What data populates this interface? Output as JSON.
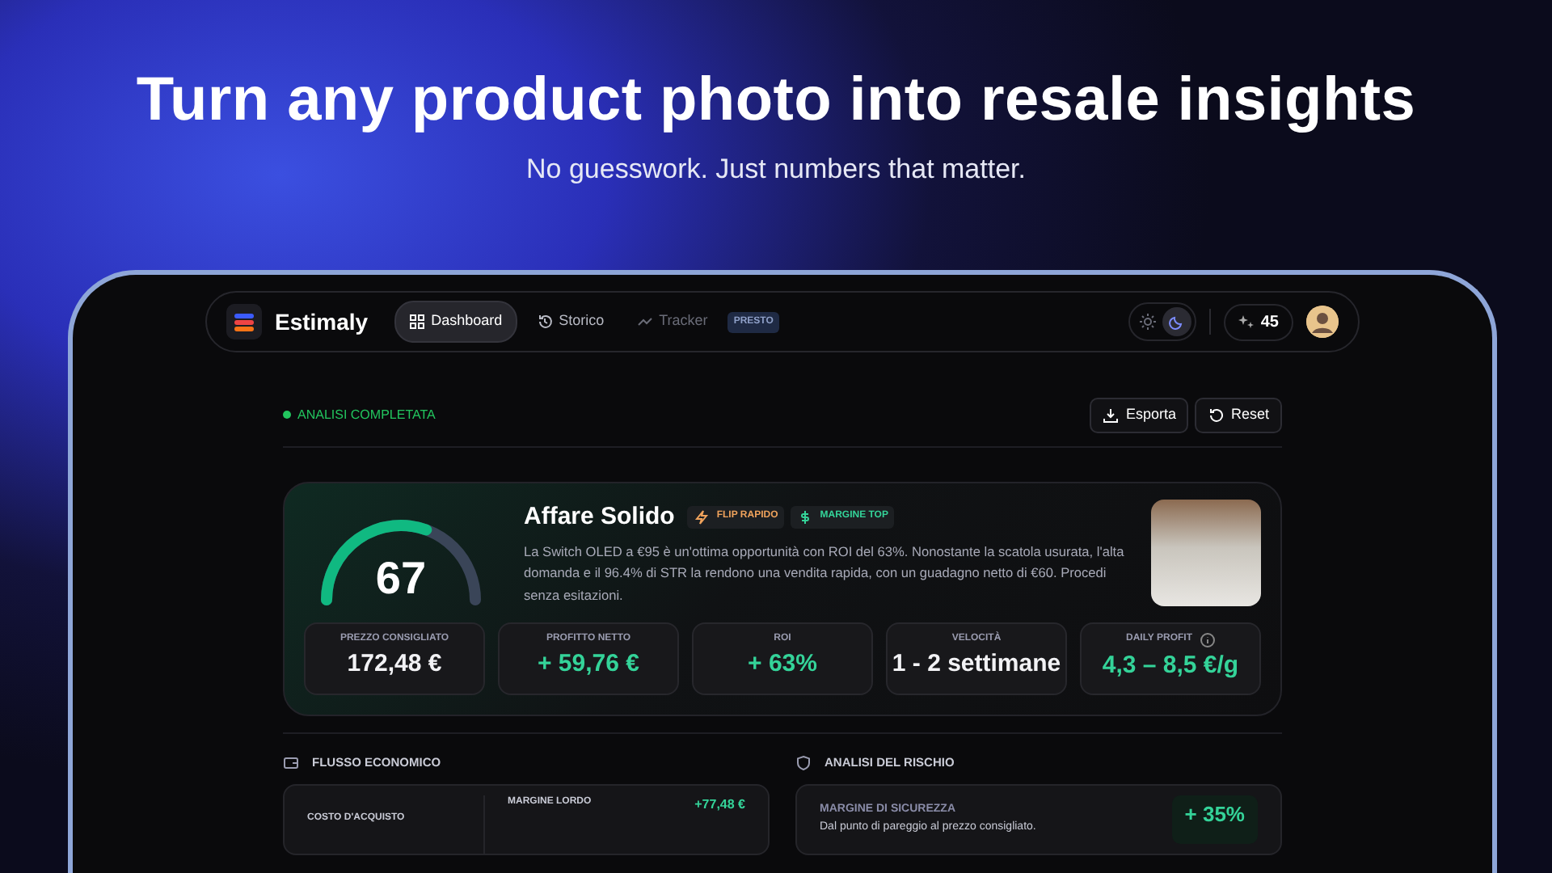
{
  "hero": {
    "title": "Turn any product photo into resale insights",
    "subtitle": "No guesswork. Just numbers that matter."
  },
  "nav": {
    "brand": "Estimaly",
    "tabs": [
      {
        "label": "Dashboard",
        "kind": "grid",
        "selected": true,
        "disabled": false
      },
      {
        "label": "Storico",
        "kind": "history",
        "selected": false,
        "disabled": false
      },
      {
        "label": "Tracker",
        "kind": "trend",
        "selected": false,
        "disabled": true,
        "badge": "PRESTO"
      }
    ],
    "theme_options": [
      {
        "kind": "sun",
        "selected": false
      },
      {
        "kind": "moon",
        "selected": true
      }
    ],
    "credits": "45"
  },
  "status": "ANALISI COMPLETATA",
  "actions": [
    {
      "label": "Esporta",
      "kind": "download"
    },
    {
      "label": "Reset",
      "kind": "reset"
    }
  ],
  "verdict": {
    "score": "67",
    "level": 0.67,
    "title": "Affare Solido",
    "tags": [
      {
        "label": "FLIP RAPIDO",
        "kind": "bolt",
        "color": "#f0a35c"
      },
      {
        "label": "MARGINE TOP",
        "kind": "dollar",
        "color": "#34d399"
      }
    ],
    "description": "La Switch OLED a €95 è un'ottima opportunità con ROI del 63%. Nonostante la scatola usurata, l'alta domanda e il 96.4% di STR la rendono una vendita rapida, con un guadagno netto di €60. Procedi senza esitazioni."
  },
  "metrics": [
    {
      "label": "PREZZO CONSIGLIATO",
      "value": "172,48 €",
      "color": "#f2f2f5",
      "info": false
    },
    {
      "label": "PROFITTO NETTO",
      "value": "+ 59,76 €",
      "color": "#34d399",
      "info": false
    },
    {
      "label": "ROI",
      "value": "+ 63%",
      "color": "#34d399",
      "info": false
    },
    {
      "label": "VELOCITÀ",
      "value": "1 - 2 settimane",
      "color": "#f2f2f5",
      "info": false
    },
    {
      "label": "DAILY PROFIT",
      "value": "4,3 – 8,5 €/g",
      "color": "#34d399",
      "info": true
    }
  ],
  "sections": [
    {
      "title": "FLUSSO ECONOMICO",
      "kind": "wallet",
      "left_label": "COSTO D'ACQUISTO",
      "row_label": "MARGINE LORDO",
      "row_value": "+77,48 €"
    },
    {
      "title": "ANALISI DEL RISCHIO",
      "kind": "shield",
      "label": "MARGINE DI SICUREZZA",
      "note": "Dal punto di pareggio al prezzo consigliato.",
      "value": "+ 35%"
    }
  ]
}
